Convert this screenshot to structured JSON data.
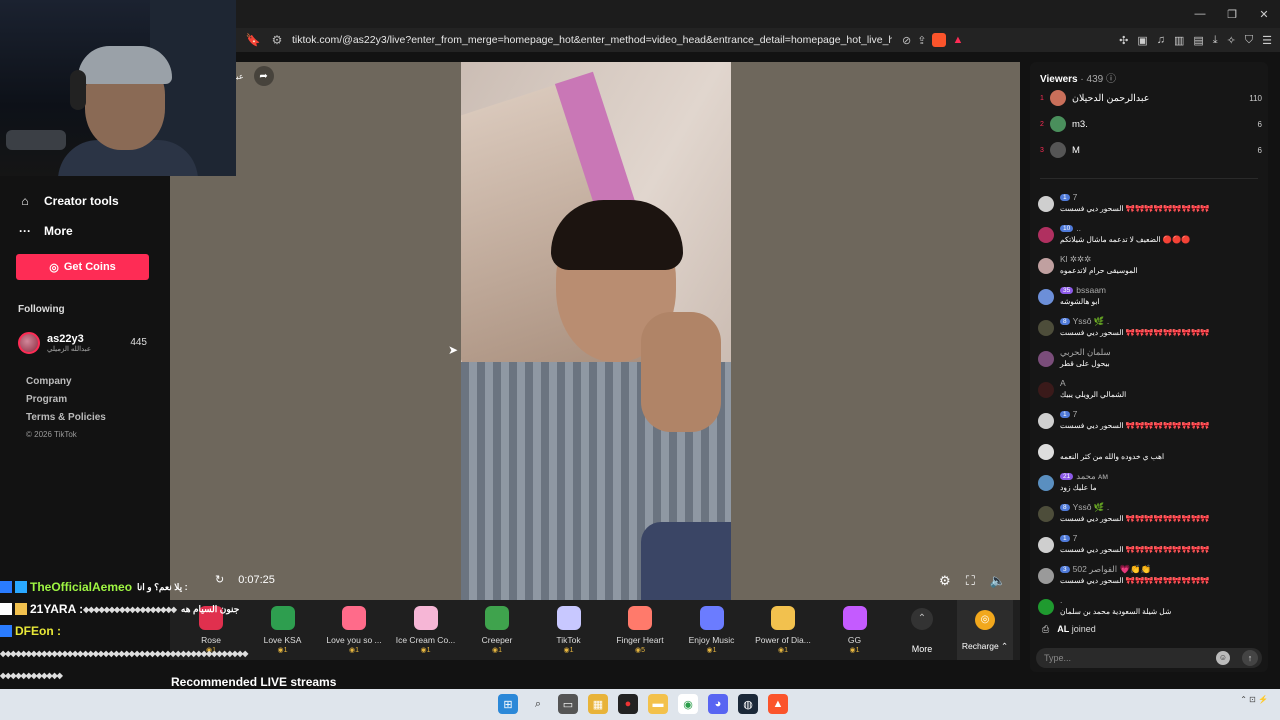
{
  "browser": {
    "url": "tiktok.com/@as22y3/live?enter_from_merge=homepage_hot&enter_method=video_head&entrance_detail=homepage_hot_live_head&from_pla..."
  },
  "sidebar": {
    "creator_tools": "Creator tools",
    "more": "More",
    "get_coins": "Get Coins",
    "following_label": "Following",
    "following": {
      "name": "as22y3",
      "subname": "عبدالله الزميلي",
      "count": "445"
    },
    "footer": {
      "company": "Company",
      "program": "Program",
      "terms": "Terms & Policies",
      "copyright": "© 2026 TikTok"
    }
  },
  "player": {
    "streamer_tag": "عبدا",
    "time": "0:07:25"
  },
  "gifts": [
    {
      "name": "Rose",
      "cost": "1",
      "color": "#e0304e"
    },
    {
      "name": "Love KSA",
      "cost": "1",
      "color": "#2e9e4f"
    },
    {
      "name": "Love you so ...",
      "cost": "1",
      "color": "#ff6b8a"
    },
    {
      "name": "Ice Cream Co...",
      "cost": "1",
      "color": "#f6b6d6"
    },
    {
      "name": "Creeper",
      "cost": "1",
      "color": "#3fa34d"
    },
    {
      "name": "TikTok",
      "cost": "1",
      "color": "#c8c8ff"
    },
    {
      "name": "Finger Heart",
      "cost": "5",
      "color": "#ff7a6b"
    },
    {
      "name": "Enjoy Music",
      "cost": "1",
      "color": "#6b7cff"
    },
    {
      "name": "Power of Dia...",
      "cost": "1",
      "color": "#f2c14e"
    },
    {
      "name": "GG",
      "cost": "1",
      "color": "#c45bff"
    }
  ],
  "gift_more": "More",
  "recharge": "Recharge",
  "recommended": "Recommended LIVE streams",
  "stream_chat": [
    {
      "user": "TheOfficialAemeo",
      "user_color": "#9ef542",
      "msg": "يلا نعم؟ و انا :"
    },
    {
      "user": "21YARA :",
      "user_color": "#ffffff",
      "msg": "جنون السيام هه"
    },
    {
      "user": "DFEon :",
      "user_color": "#e8e838",
      "msg": ""
    }
  ],
  "chat_panel": {
    "viewers_label": "Viewers",
    "viewers_count": "· 439",
    "top_viewers": [
      {
        "rank": "1",
        "name": "عبدالرحمن الدحيلان",
        "score": "110",
        "color": "#c96f5a"
      },
      {
        "rank": "2",
        "name": "m3.",
        "score": "6",
        "color": "#4a8f5c"
      },
      {
        "rank": "3",
        "name": "M",
        "score": "6",
        "color": "#555"
      }
    ],
    "messages": [
      {
        "level": "1",
        "name": "7",
        "text": "السحور ديي فسست 🎀🎀🎀🎀🎀🎀🎀🎀🎀",
        "color": "#cfcfcf"
      },
      {
        "level": "10",
        "name": "..",
        "text": "الضعيف لا تدعمه ماشال شيلاتكم 🔴🔴🔴",
        "color": "#b03060"
      },
      {
        "level": "",
        "name": "Kl ✲✲✲",
        "text": "الموسيقى حرام لاتدعموه",
        "color": "#c0a0a0"
      },
      {
        "level": "35",
        "name": "bssaam",
        "text": "ابو هالشوشه",
        "color": "#6c8fd8"
      },
      {
        "level": "8",
        "name": "Yssô 🌿 .",
        "text": "السحور ديي فسست 🎀🎀🎀🎀🎀🎀🎀🎀🎀",
        "color": "#4d4d3a"
      },
      {
        "level": "",
        "name": "سلمان الحربي",
        "text": "بيحول على قطر",
        "color": "#7a4d7a"
      },
      {
        "level": "",
        "name": "A",
        "text": "الشمالي الرويلي يبيك",
        "color": "#3a1a1a"
      },
      {
        "level": "1",
        "name": "7",
        "text": "السحور ديي فسست 🎀🎀🎀🎀🎀🎀🎀🎀🎀",
        "color": "#cfcfcf"
      },
      {
        "level": "",
        "name": "",
        "text": "اهب ي خدوده والله من كثر النعمه",
        "color": "#dddddd"
      },
      {
        "level": "21",
        "name": "محمد ᴀᴍ",
        "text": "ما عليك زود",
        "color": "#5a8fc0"
      },
      {
        "level": "8",
        "name": "Yssô 🌿 .",
        "text": "السحور ديي فسست 🎀🎀🎀🎀🎀🎀🎀🎀🎀",
        "color": "#4d4d3a"
      },
      {
        "level": "1",
        "name": "7",
        "text": "السحور ديي فسست 🎀🎀🎀🎀🎀🎀🎀🎀🎀",
        "color": "#cfcfcf"
      },
      {
        "level": "3",
        "name": "502 الفواصر 💗👏👏",
        "text": "السحور ديي فسست 🎀🎀🎀🎀🎀🎀🎀🎀🎀",
        "color": "#9a9a9a"
      },
      {
        "level": "",
        "name": ".",
        "text": "شل شيلة السعودية محمد بن سلمان",
        "color": "#1f9a2f"
      }
    ],
    "joined_user": "AL",
    "joined_text": "joined",
    "input_placeholder": "Type..."
  }
}
